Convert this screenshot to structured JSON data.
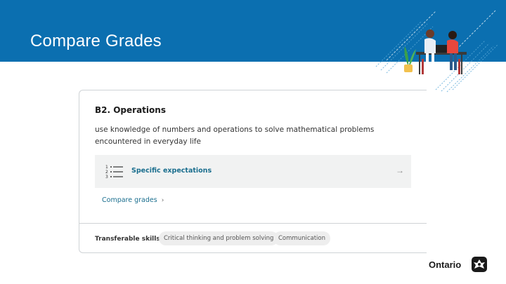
{
  "banner": {
    "title": "Compare Grades"
  },
  "card": {
    "heading": "B2. Operations",
    "description": "use knowledge of numbers and operations to solve mathematical problems encountered in everyday life",
    "specific_expectations_label": "Specific expectations",
    "compare_grades_label": "Compare grades",
    "transferable_skills_label": "Transferable skills:",
    "skills": [
      "Critical thinking and problem solving",
      "Communication"
    ]
  },
  "footer": {
    "logo_text": "Ontario"
  },
  "icons": {
    "list": "numbered-list-icon",
    "arrow": "arrow-right-icon",
    "chevron": "chevron-right-icon",
    "logo": "trillium-icon"
  },
  "colors": {
    "banner": "#0b6fb0",
    "link": "#1a6e8e",
    "row_bg": "#f1f2f2"
  }
}
